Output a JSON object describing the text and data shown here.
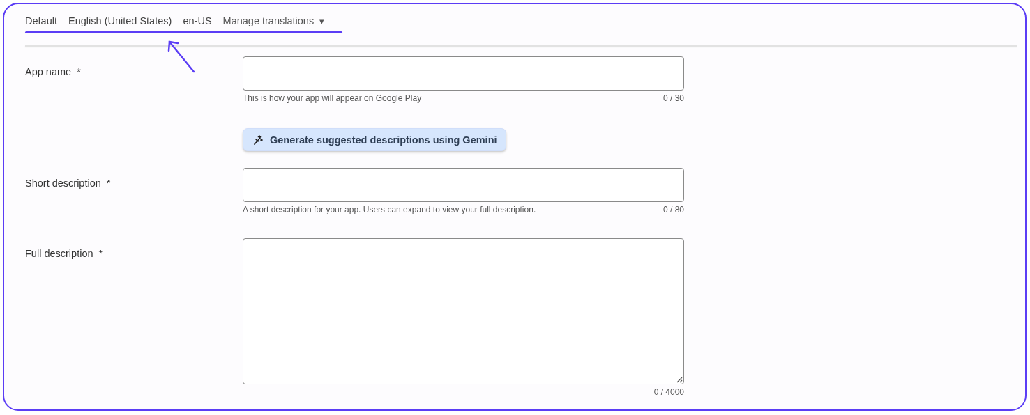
{
  "header": {
    "language": "Default – English (United States) – en-US",
    "menu": {
      "label": "Manage translations",
      "caret": "▾"
    }
  },
  "fields": [
    {
      "kind": "input",
      "label": "App name",
      "required_mark": "*",
      "helper": "This is how your app will appear on Google Play",
      "counter": "0 / 30"
    },
    {
      "kind": "button",
      "label": "Generate suggested descriptions using Gemini"
    },
    {
      "kind": "input",
      "label": "Short description",
      "required_mark": "*",
      "helper": "A short description for your app. Users can expand to view your full description.",
      "counter": "0 / 80"
    },
    {
      "kind": "textarea",
      "label": "Full description",
      "required_mark": "*",
      "counter": "0 / 4000"
    }
  ]
}
